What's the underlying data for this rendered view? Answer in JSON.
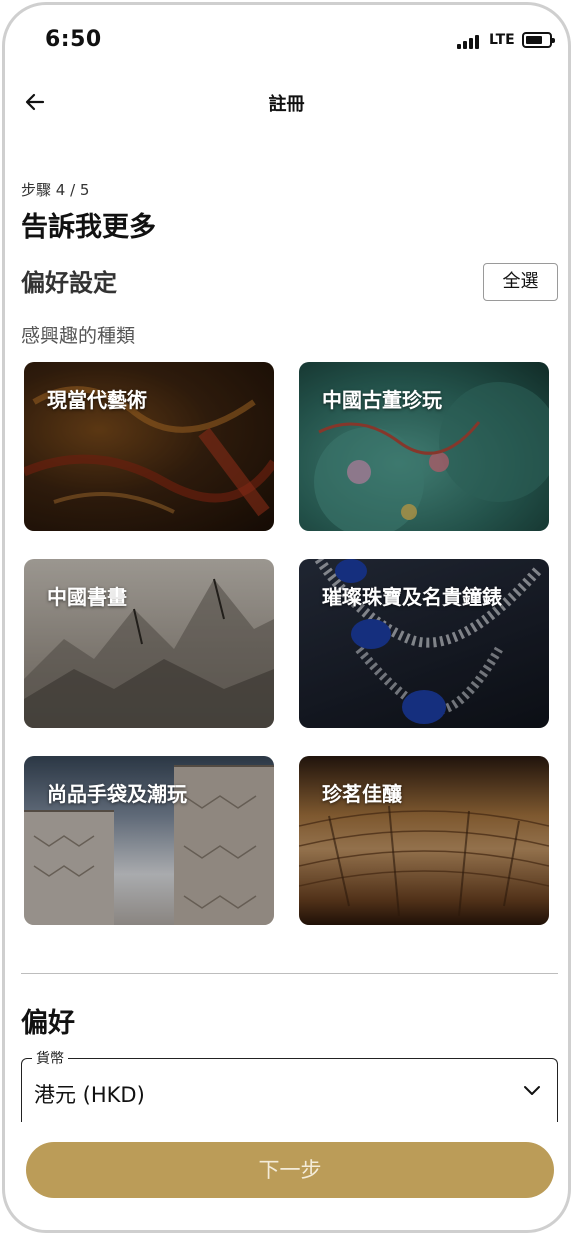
{
  "status_bar": {
    "time": "6:50",
    "network": "LTE"
  },
  "nav": {
    "title": "註冊"
  },
  "step": {
    "label": "步驟 4 / 5",
    "heading": "告訴我更多"
  },
  "preferences_section": {
    "title": "偏好設定",
    "select_all": "全選",
    "categories_label": "感興趣的種類",
    "categories": [
      {
        "label": "現當代藝術"
      },
      {
        "label": "中國古董珍玩"
      },
      {
        "label": "中國書畫"
      },
      {
        "label": "璀璨珠寶及名貴鐘錶"
      },
      {
        "label": "尚品手袋及潮玩"
      },
      {
        "label": "珍茗佳釀"
      }
    ]
  },
  "preference": {
    "title": "偏好",
    "currency_label": "貨幣",
    "currency_value": "港元 (HKD)"
  },
  "next_button": "下一步",
  "colors": {
    "accent": "#bb9c58"
  }
}
